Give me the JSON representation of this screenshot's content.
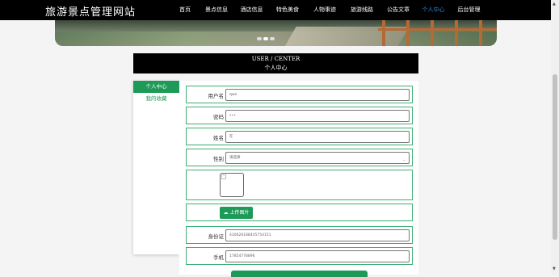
{
  "site": {
    "brand": "旅游景点管理网站"
  },
  "nav": [
    {
      "label": "首页",
      "active": false
    },
    {
      "label": "景点信息",
      "active": false
    },
    {
      "label": "酒店信息",
      "active": false
    },
    {
      "label": "特色美食",
      "active": false
    },
    {
      "label": "人物事迹",
      "active": false
    },
    {
      "label": "旅游线路",
      "active": false
    },
    {
      "label": "公告文章",
      "active": false
    },
    {
      "label": "个人中心",
      "active": true
    },
    {
      "label": "后台管理",
      "active": false
    }
  ],
  "header": {
    "en": "USER / CENTER",
    "zh": "个人中心"
  },
  "sidebar": {
    "items": [
      {
        "label": "个人中心"
      },
      {
        "label": "我的收藏"
      }
    ]
  },
  "form": {
    "username": {
      "label": "用户名",
      "value": "qwe"
    },
    "password": {
      "label": "密码",
      "value": "•••"
    },
    "name": {
      "label": "姓名",
      "value": "在"
    },
    "gender": {
      "label": "性别",
      "placeholder": "请选择"
    },
    "upload_label": "上传图片",
    "id_card": {
      "label": "身份证",
      "value": "430626188445754151"
    },
    "phone": {
      "label": "手机",
      "value": "17854778896"
    }
  },
  "colors": {
    "accent": "#1e9a58",
    "nav_active": "#2f8ad8",
    "bar": "#000000"
  },
  "icons": {
    "upload": "cloud-upload-icon",
    "select": "chevron-down-icon"
  }
}
